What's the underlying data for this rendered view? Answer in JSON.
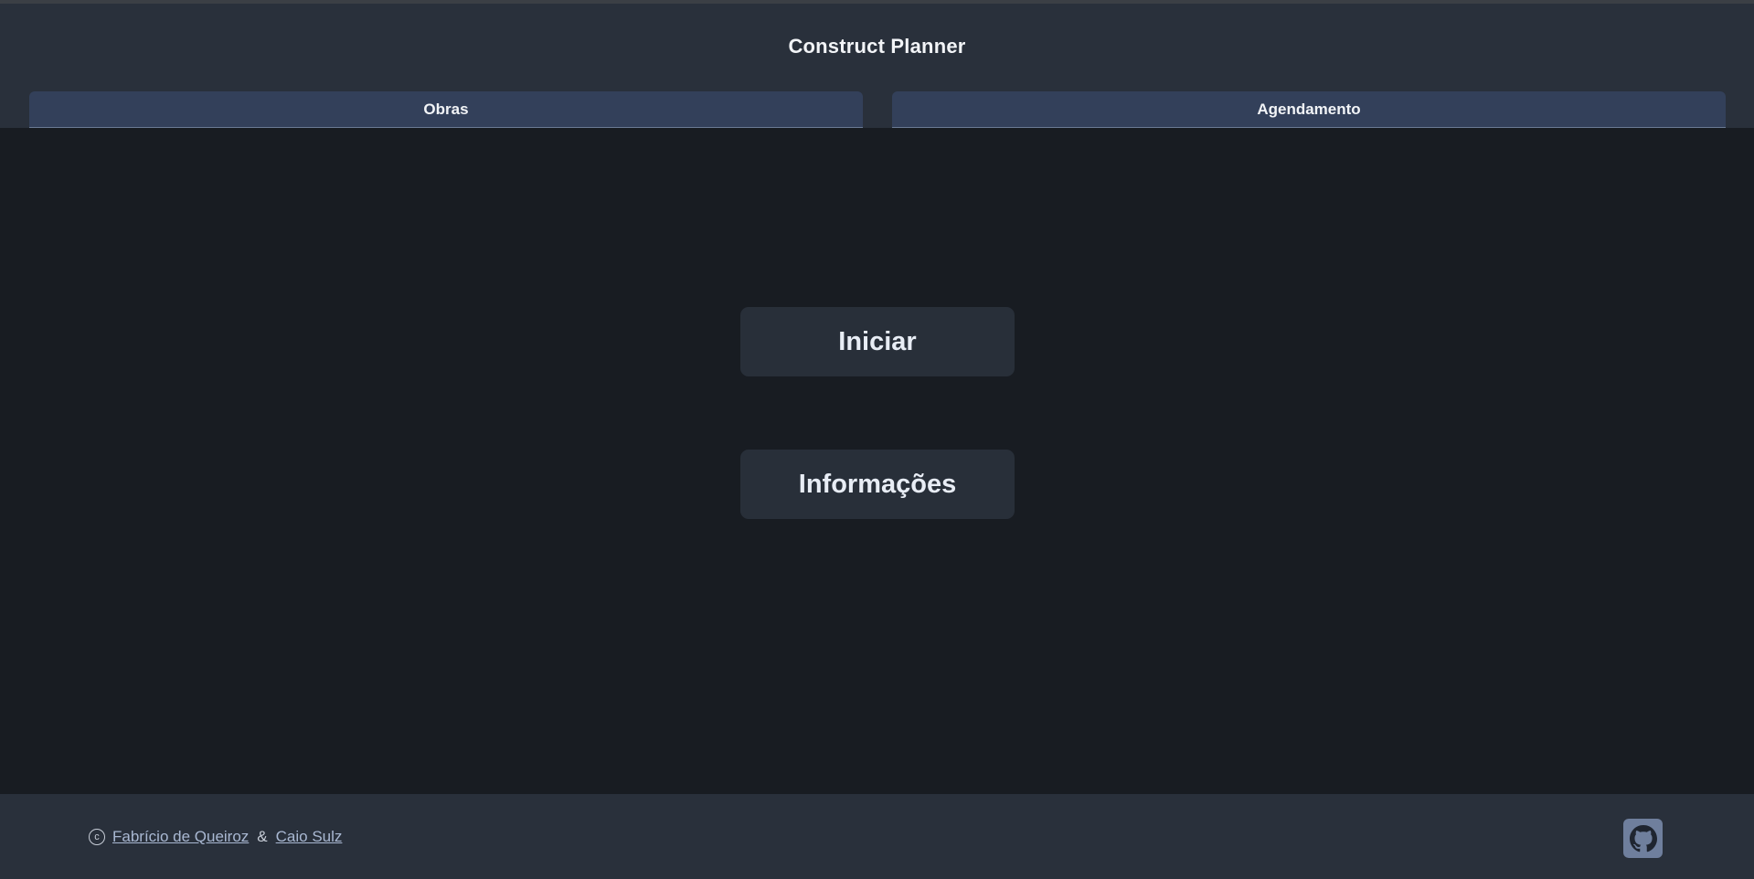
{
  "header": {
    "title": "Construct Planner",
    "tabs": [
      {
        "label": "Obras"
      },
      {
        "label": "Agendamento"
      }
    ]
  },
  "main": {
    "buttons": [
      {
        "label": "Iniciar"
      },
      {
        "label": "Informações"
      }
    ]
  },
  "footer": {
    "copyright_symbol": "c",
    "authors": [
      "Fabrício de Queiroz",
      "Caio Sulz"
    ],
    "separator": "&",
    "github_icon": "github-icon"
  },
  "colors": {
    "background": "#181c22",
    "header_bg": "#29303b",
    "tab_bg": "#33405a",
    "button_bg": "#282f39",
    "link": "#a9b8d2",
    "github_bg": "#6f7f9d"
  }
}
